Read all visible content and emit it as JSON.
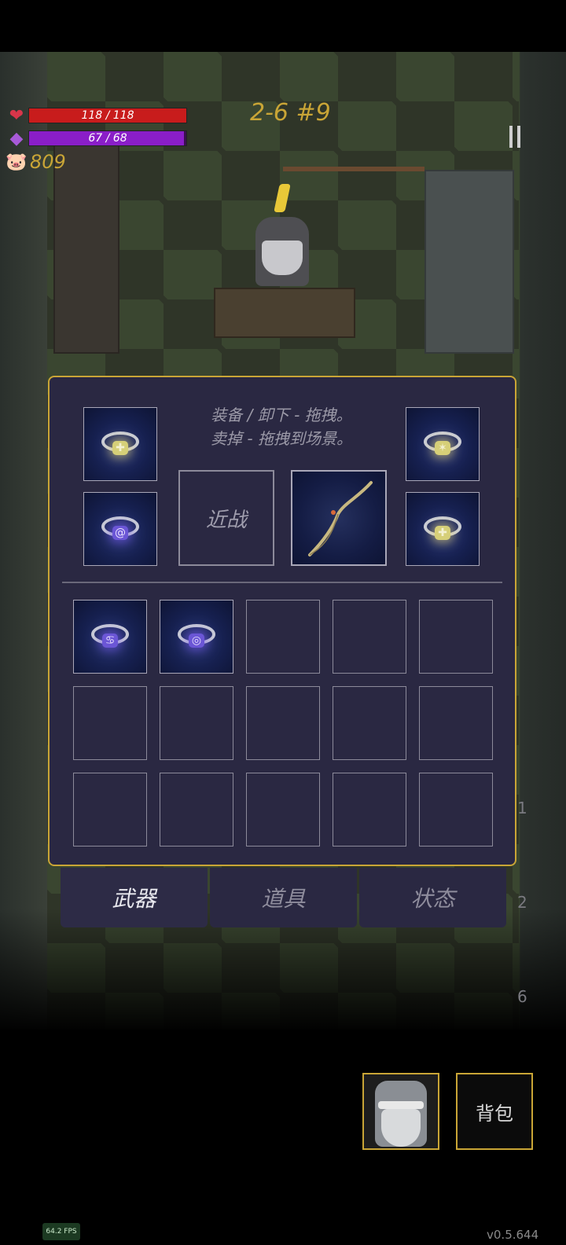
{
  "hud": {
    "health": {
      "text": "118 / 118",
      "current": 118,
      "max": 118,
      "color": "#c81c1c"
    },
    "mana": {
      "text": "67 / 68",
      "current": 67,
      "max": 68,
      "color": "#8a1ec8"
    },
    "gold": "809",
    "level": "2-6 #9"
  },
  "equipment": {
    "hint_line1": "装备 / 卸下 - 拖拽。",
    "hint_line2": "卖掉 - 拖拽到场景。",
    "melee_label": "近战"
  },
  "tabs": [
    {
      "label": "武器",
      "active": true
    },
    {
      "label": "道具",
      "active": false
    },
    {
      "label": "状态",
      "active": false
    }
  ],
  "side_counts": [
    "1",
    "2",
    "6"
  ],
  "bottom": {
    "bag_label": "背包"
  },
  "fps": "64.2 FPS",
  "version": "v0.5.644"
}
